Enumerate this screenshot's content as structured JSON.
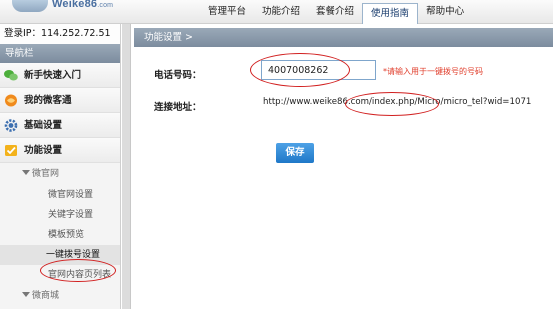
{
  "header": {
    "logo_text": "Weike86",
    "logo_suffix": ".com",
    "nav": [
      "管理平台",
      "功能介绍",
      "套餐介绍",
      "使用指南",
      "帮助中心"
    ],
    "active_nav": "使用指南"
  },
  "sidebar": {
    "login_ip": "登录IP：114.252.72.51",
    "nav_header": "导航栏",
    "groups": [
      {
        "label": "新手快速入门",
        "icon": "chat-bubbles-icon"
      },
      {
        "label": "我的微客通",
        "icon": "globe-icon"
      },
      {
        "label": "基础设置",
        "icon": "gear-icon"
      },
      {
        "label": "功能设置",
        "icon": "checkbox-icon"
      }
    ],
    "sub_group": "微官网",
    "sub_items": [
      "微官网设置",
      "关键字设置",
      "模板预览",
      "一键拨号设置",
      "官网内容页列表"
    ],
    "active_sub_item": "一键拨号设置",
    "next_group_partial": "微商城"
  },
  "main": {
    "breadcrumb": "功能设置 >",
    "phone_label": "电话号码：",
    "phone_value": "4007008262",
    "phone_hint": "*请输入用于一键拨号的号码",
    "url_label": "连接地址：",
    "url_value": "http://www.weike86.com/index.php/Micro/micro_tel?wid=1071",
    "save_label": "保存"
  },
  "colors": {
    "accent_blue": "#1f78c8",
    "annotation_red": "#d11f1f",
    "hint_red": "#e03c2a",
    "bar_gray": "#8797a8"
  }
}
